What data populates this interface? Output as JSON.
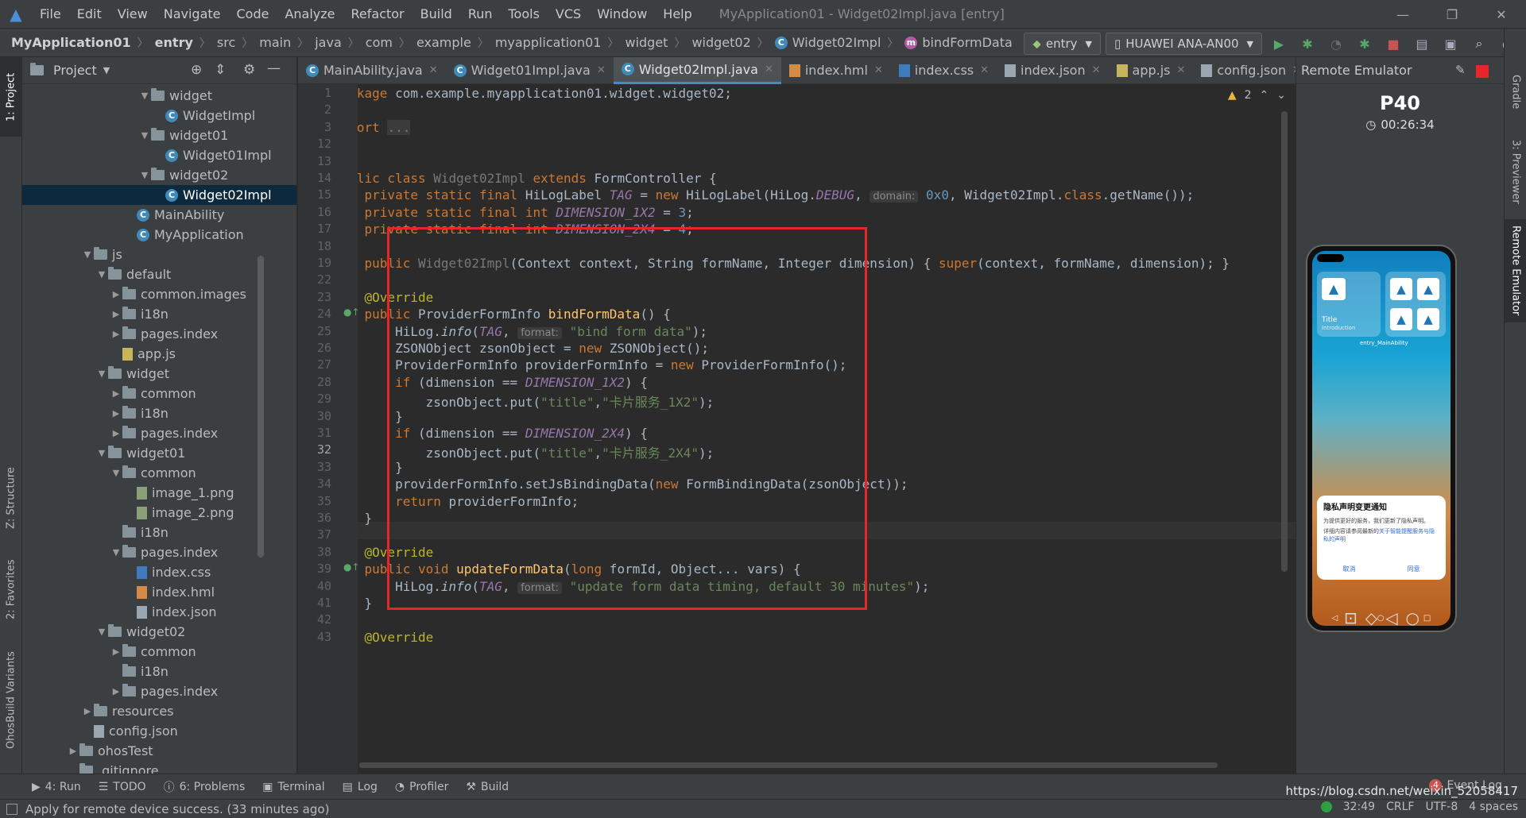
{
  "menu": {
    "items": [
      "File",
      "Edit",
      "View",
      "Navigate",
      "Code",
      "Analyze",
      "Refactor",
      "Build",
      "Run",
      "Tools",
      "VCS",
      "Window",
      "Help"
    ],
    "title": "MyApplication01 - Widget02Impl.java [entry]"
  },
  "breadcrumb": [
    "MyApplication01",
    "entry",
    "src",
    "main",
    "java",
    "com",
    "example",
    "myapplication01",
    "widget",
    "widget02",
    "Widget02Impl",
    "bindFormData"
  ],
  "toolbar": {
    "module_select": "entry",
    "device_select": "HUAWEI ANA-AN00"
  },
  "project_panel": {
    "title": "Project",
    "tree": [
      {
        "indent": 1,
        "arrow": "down",
        "type": "folder",
        "label": "widget"
      },
      {
        "indent": 2,
        "arrow": "",
        "type": "class",
        "label": "WidgetImpl"
      },
      {
        "indent": 1,
        "arrow": "down",
        "type": "folder",
        "label": "widget01"
      },
      {
        "indent": 2,
        "arrow": "",
        "type": "class",
        "label": "Widget01Impl"
      },
      {
        "indent": 1,
        "arrow": "down",
        "type": "folder",
        "label": "widget02"
      },
      {
        "indent": 2,
        "arrow": "",
        "type": "class",
        "label": "Widget02Impl",
        "selected": true
      },
      {
        "indent": 0,
        "arrow": "",
        "type": "class",
        "label": "MainAbility"
      },
      {
        "indent": 0,
        "arrow": "",
        "type": "class",
        "label": "MyApplication"
      },
      {
        "indent": -3,
        "arrow": "down",
        "type": "folder",
        "label": "js"
      },
      {
        "indent": -2,
        "arrow": "down",
        "type": "folder",
        "label": "default"
      },
      {
        "indent": -1,
        "arrow": "right",
        "type": "folder",
        "label": "common.images"
      },
      {
        "indent": -1,
        "arrow": "right",
        "type": "folder",
        "label": "i18n"
      },
      {
        "indent": -1,
        "arrow": "right",
        "type": "folder",
        "label": "pages.index"
      },
      {
        "indent": -1,
        "arrow": "",
        "type": "js",
        "label": "app.js"
      },
      {
        "indent": -2,
        "arrow": "down",
        "type": "folder",
        "label": "widget"
      },
      {
        "indent": -1,
        "arrow": "right",
        "type": "folder",
        "label": "common"
      },
      {
        "indent": -1,
        "arrow": "right",
        "type": "folder",
        "label": "i18n"
      },
      {
        "indent": -1,
        "arrow": "right",
        "type": "folder",
        "label": "pages.index"
      },
      {
        "indent": -2,
        "arrow": "down",
        "type": "folder",
        "label": "widget01"
      },
      {
        "indent": -1,
        "arrow": "down",
        "type": "folder",
        "label": "common"
      },
      {
        "indent": 0,
        "arrow": "",
        "type": "img",
        "label": "image_1.png"
      },
      {
        "indent": 0,
        "arrow": "",
        "type": "img",
        "label": "image_2.png"
      },
      {
        "indent": -1,
        "arrow": "",
        "type": "folder",
        "label": "i18n"
      },
      {
        "indent": -1,
        "arrow": "down",
        "type": "folder",
        "label": "pages.index"
      },
      {
        "indent": 0,
        "arrow": "",
        "type": "css",
        "label": "index.css"
      },
      {
        "indent": 0,
        "arrow": "",
        "type": "hml",
        "label": "index.hml"
      },
      {
        "indent": 0,
        "arrow": "",
        "type": "json",
        "label": "index.json"
      },
      {
        "indent": -2,
        "arrow": "down",
        "type": "folder",
        "label": "widget02"
      },
      {
        "indent": -1,
        "arrow": "right",
        "type": "folder",
        "label": "common"
      },
      {
        "indent": -1,
        "arrow": "",
        "type": "folder",
        "label": "i18n"
      },
      {
        "indent": -1,
        "arrow": "right",
        "type": "folder",
        "label": "pages.index"
      },
      {
        "indent": -3,
        "arrow": "right",
        "type": "folder",
        "label": "resources"
      },
      {
        "indent": -3,
        "arrow": "",
        "type": "json",
        "label": "config.json"
      },
      {
        "indent": -4,
        "arrow": "right",
        "type": "folder",
        "label": "ohosTest"
      },
      {
        "indent": -4,
        "arrow": "",
        "type": "folder",
        "label": ".gitignore"
      }
    ]
  },
  "tabs": [
    {
      "label": "MainAbility.java",
      "icon": "class"
    },
    {
      "label": "Widget01Impl.java",
      "icon": "class"
    },
    {
      "label": "Widget02Impl.java",
      "icon": "class",
      "active": true
    },
    {
      "label": "index.hml",
      "icon": "hml"
    },
    {
      "label": "index.css",
      "icon": "css"
    },
    {
      "label": "index.json",
      "icon": "json"
    },
    {
      "label": "app.js",
      "icon": "js"
    },
    {
      "label": "config.json",
      "icon": "json"
    }
  ],
  "editor": {
    "warnings": "2",
    "line_numbers": [
      "1",
      "2",
      "3",
      "12",
      "13",
      "14",
      "15",
      "16",
      "17",
      "18",
      "19",
      "22",
      "23",
      "24",
      "25",
      "26",
      "27",
      "28",
      "29",
      "30",
      "31",
      "32",
      "33",
      "34",
      "35",
      "36",
      "37",
      "38",
      "39",
      "40",
      "41",
      "42",
      "43"
    ],
    "current_line": "32",
    "hints": {
      "domain": "domain:",
      "format": "format:"
    }
  },
  "left_stripe": {
    "project": "1: Project",
    "structure": "Z: Structure",
    "favorites": "2: Favorites",
    "variants": "OhosBuild Variants"
  },
  "right_stripe": {
    "gradle": "Gradle",
    "previewer": "3: Previewer",
    "remote": "Remote Emulator"
  },
  "emulator": {
    "title": "Remote Emulator",
    "device": "P40",
    "timer": "00:26:34",
    "widget_title": "Title",
    "widget_intro": "Introduction",
    "widget_label": "entry_MainAbility",
    "dialog_title": "隐私声明变更通知",
    "dialog_body": "为提供更好的服务，我们更新了隐私声明。",
    "dialog_body2": "详细内容请参阅最新的",
    "dialog_link": "关于智能提醒服务与隐私的声明",
    "dialog_cancel": "取消",
    "dialog_agree": "同意"
  },
  "bottom_tabs": [
    "4: Run",
    "TODO",
    "6: Problems",
    "Terminal",
    "Log",
    "Profiler",
    "Build"
  ],
  "event_log": "Event Log",
  "event_count": "4",
  "status": {
    "message": "Apply for remote device success. (33 minutes ago)",
    "position": "32:49",
    "line_sep": "CRLF",
    "encoding": "UTF-8",
    "indent": "4 spaces",
    "watermark": "https://blog.csdn.net/weixin_52058417"
  },
  "colors": {
    "highlight_box": "#e8262a",
    "keyword": "#cc7832",
    "string": "#6a8759",
    "number": "#6897bb"
  }
}
